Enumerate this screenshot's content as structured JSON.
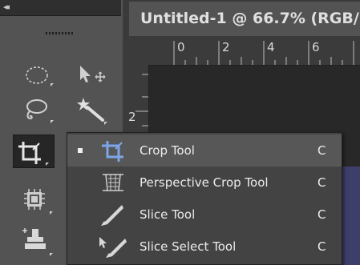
{
  "toolbar": {
    "collapse_glyph": "◂◂",
    "tools": [
      {
        "name": "elliptical-marquee-icon"
      },
      {
        "name": "move-tool-icon"
      },
      {
        "name": "lasso-icon"
      },
      {
        "name": "magic-wand-icon"
      },
      {
        "name": "crop-icon"
      },
      {
        "name": "eyedropper-icon"
      },
      {
        "name": "spot-healing-icon"
      },
      {
        "name": "brush-icon"
      },
      {
        "name": "clone-stamp-icon"
      }
    ]
  },
  "document": {
    "tab_title": "Untitled-1 @ 66.7% (RGB/",
    "ruler_h_labels": [
      "0",
      "2",
      "4",
      "6"
    ],
    "ruler_v_labels": [
      "2"
    ]
  },
  "flyout": {
    "items": [
      {
        "label": "Crop Tool",
        "shortcut": "C",
        "icon": "crop-tool-icon",
        "selected": true
      },
      {
        "label": "Perspective Crop Tool",
        "shortcut": "C",
        "icon": "perspective-crop-icon",
        "selected": false
      },
      {
        "label": "Slice Tool",
        "shortcut": "C",
        "icon": "slice-tool-icon",
        "selected": false
      },
      {
        "label": "Slice Select Tool",
        "shortcut": "C",
        "icon": "slice-select-icon",
        "selected": false
      }
    ]
  },
  "colors": {
    "panel": "#535353",
    "canvas": "#282828",
    "menu": "#434343",
    "menu_selected": "#575757"
  }
}
